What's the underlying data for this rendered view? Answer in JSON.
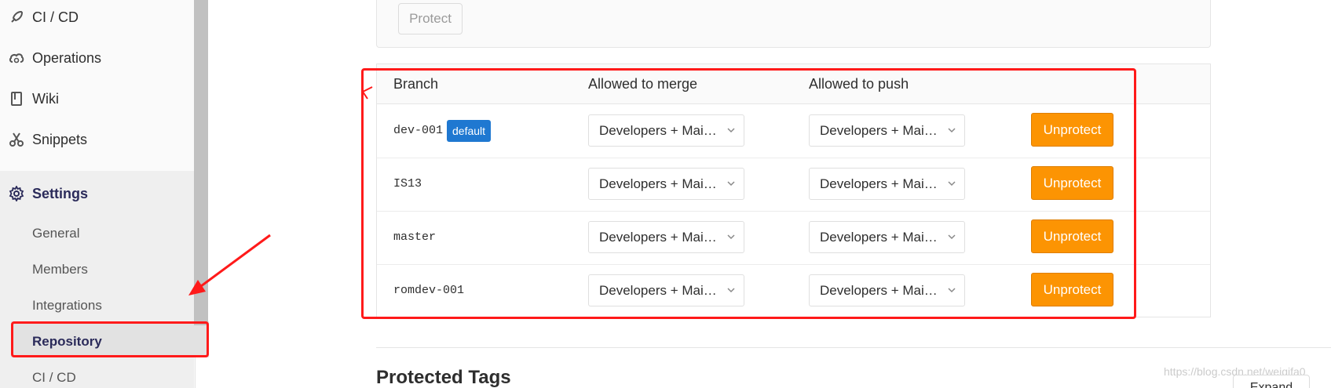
{
  "sidebar": {
    "items": [
      {
        "label": "CI / CD",
        "icon": "rocket-icon"
      },
      {
        "label": "Operations",
        "icon": "cloud-gear-icon"
      },
      {
        "label": "Wiki",
        "icon": "book-icon"
      },
      {
        "label": "Snippets",
        "icon": "scissors-icon"
      },
      {
        "label": "Settings",
        "icon": "gear-icon"
      }
    ],
    "settings_sub": [
      {
        "label": "General"
      },
      {
        "label": "Members"
      },
      {
        "label": "Integrations"
      },
      {
        "label": "Repository"
      },
      {
        "label": "CI / CD"
      }
    ]
  },
  "protect_panel": {
    "protect_label": "Protect"
  },
  "table": {
    "headers": [
      "Branch",
      "Allowed to merge",
      "Allowed to push"
    ],
    "rows": [
      {
        "branch": "dev-001",
        "badge": "default",
        "merge": "Developers + Maintainers",
        "push": "Developers + Maintainers",
        "action": "Unprotect"
      },
      {
        "branch": "IS13",
        "badge": "",
        "merge": "Developers + Maintainers",
        "push": "Developers + Maintainers",
        "action": "Unprotect"
      },
      {
        "branch": "master",
        "badge": "",
        "merge": "Developers + Maintainers",
        "push": "Developers + Maintainers",
        "action": "Unprotect"
      },
      {
        "branch": "romdev-001",
        "badge": "",
        "merge": "Developers + Maintainers",
        "push": "Developers + Maintainers",
        "action": "Unprotect"
      }
    ]
  },
  "tags_section": {
    "title": "Protected Tags",
    "expand_label": "Expand"
  },
  "watermark": "https://blog.csdn.net/weiqifa0",
  "colors": {
    "accent": "#1f78d1",
    "warning": "#fc9403",
    "annotation": "#ff1a1a"
  }
}
